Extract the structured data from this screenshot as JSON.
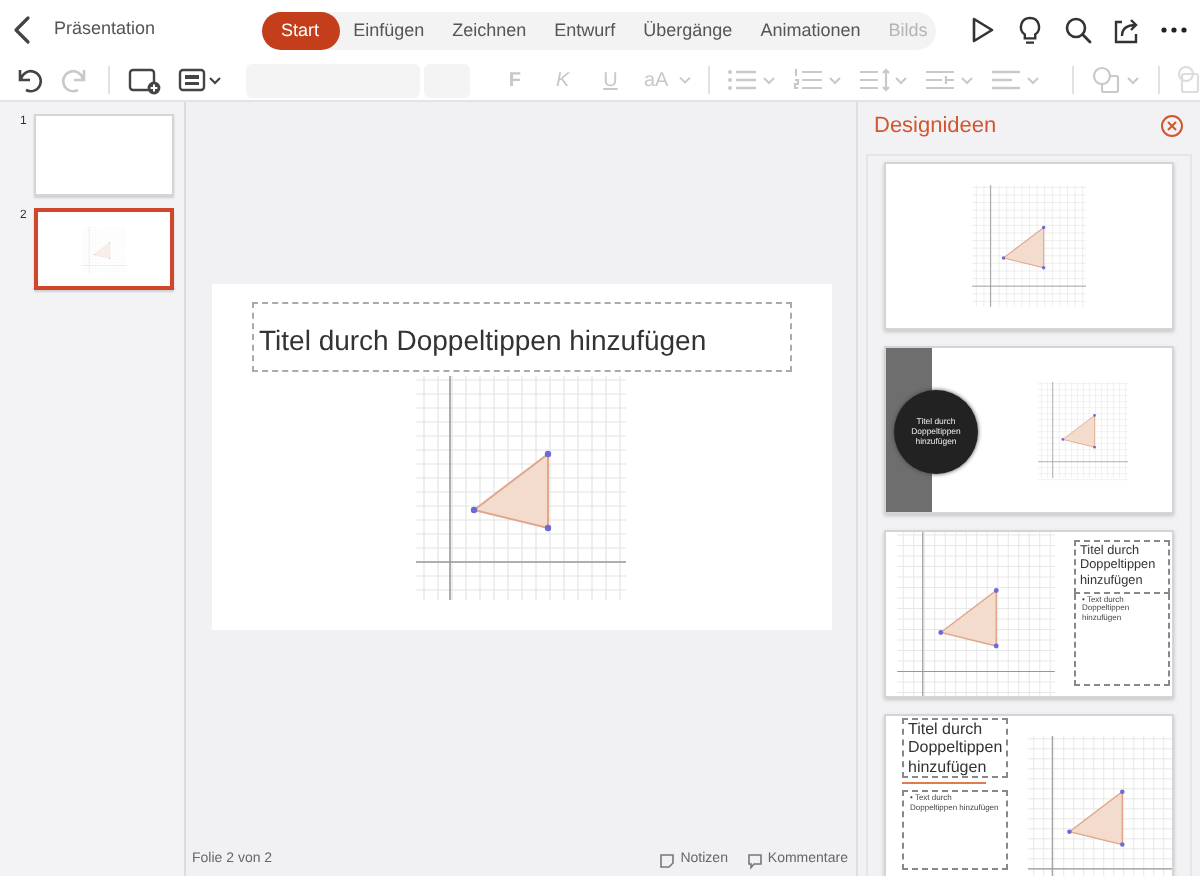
{
  "top_bar": {
    "document_title": "Präsentation"
  },
  "tabs": [
    {
      "label": "Start",
      "selected": true,
      "faded": false
    },
    {
      "label": "Einfügen",
      "selected": false,
      "faded": false
    },
    {
      "label": "Zeichnen",
      "selected": false,
      "faded": false
    },
    {
      "label": "Entwurf",
      "selected": false,
      "faded": false
    },
    {
      "label": "Übergänge",
      "selected": false,
      "faded": false
    },
    {
      "label": "Animationen",
      "selected": false,
      "faded": false
    },
    {
      "label": "Bilds",
      "selected": false,
      "faded": true
    }
  ],
  "toolbar": {
    "format_buttons": [
      "F",
      "K",
      "U",
      "aA"
    ]
  },
  "slides": [
    {
      "number": "1",
      "selected": false,
      "kind": "blank"
    },
    {
      "number": "2",
      "selected": true,
      "kind": "graph"
    }
  ],
  "slide": {
    "title_placeholder": "Titel durch Doppeltippen hinzufügen"
  },
  "design_pane": {
    "title": "Designideen",
    "ideas": [
      {
        "kind": "graph-only"
      },
      {
        "kind": "circle-title",
        "title": "Titel durch Doppeltippen hinzufügen"
      },
      {
        "kind": "graph-left",
        "title": "Titel durch Doppeltippen hinzufügen",
        "body": "• Text durch Doppeltippen hinzufügen"
      },
      {
        "kind": "title-left",
        "title": "Titel durch Doppeltippen hinzufügen",
        "body": "• Text durch Doppeltippen hinzufügen"
      }
    ]
  },
  "status_bar": {
    "slide_info": "Folie 2 von 2",
    "notes": "Notizen",
    "comments": "Kommentare"
  }
}
